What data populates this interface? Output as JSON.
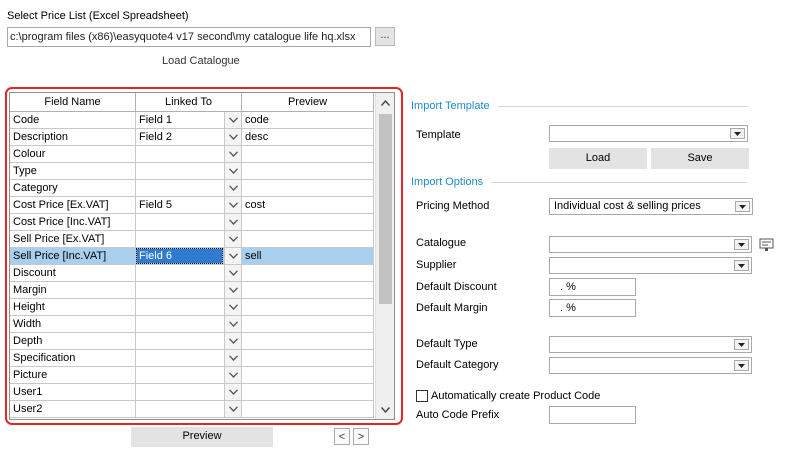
{
  "source": {
    "heading": "Select Price List (Excel Spreadsheet)",
    "path_value": "c:\\program files (x86)\\easyquote4 v17 second\\my catalogue life hq.xlsx",
    "browse_label": "...",
    "load_catalogue_label": "Load Catalogue"
  },
  "grid": {
    "headers": [
      "Field Name",
      "Linked To",
      "Preview"
    ],
    "rows": [
      {
        "field": "Code",
        "linked": "Field 1",
        "preview": "code"
      },
      {
        "field": "Description",
        "linked": "Field 2",
        "preview": "desc"
      },
      {
        "field": "Colour",
        "linked": "",
        "preview": ""
      },
      {
        "field": "Type",
        "linked": "",
        "preview": ""
      },
      {
        "field": "Category",
        "linked": "",
        "preview": ""
      },
      {
        "field": "Cost Price [Ex.VAT]",
        "linked": "Field 5",
        "preview": "cost"
      },
      {
        "field": "Cost Price [Inc.VAT]",
        "linked": "",
        "preview": ""
      },
      {
        "field": "Sell Price [Ex.VAT]",
        "linked": "",
        "preview": ""
      },
      {
        "field": "Sell Price [Inc.VAT]",
        "linked": "Field 6",
        "preview": "sell"
      },
      {
        "field": "Discount",
        "linked": "",
        "preview": ""
      },
      {
        "field": "Margin",
        "linked": "",
        "preview": ""
      },
      {
        "field": "Height",
        "linked": "",
        "preview": ""
      },
      {
        "field": "Width",
        "linked": "",
        "preview": ""
      },
      {
        "field": "Depth",
        "linked": "",
        "preview": ""
      },
      {
        "field": "Specification",
        "linked": "",
        "preview": ""
      },
      {
        "field": "Picture",
        "linked": "",
        "preview": ""
      },
      {
        "field": "User1",
        "linked": "",
        "preview": ""
      },
      {
        "field": "User2",
        "linked": "",
        "preview": ""
      }
    ],
    "selected_row_index": 8
  },
  "preview_button_label": "Preview",
  "nav": {
    "prev": "<",
    "next": ">"
  },
  "import_template": {
    "title": "Import Template",
    "template_label": "Template",
    "template_value": "",
    "load_label": "Load",
    "save_label": "Save"
  },
  "import_options": {
    "title": "Import Options",
    "pricing_method_label": "Pricing Method",
    "pricing_method_value": "Individual cost & selling prices",
    "catalogue_label": "Catalogue",
    "catalogue_value": "",
    "supplier_label": "Supplier",
    "supplier_value": "",
    "default_discount_label": "Default Discount",
    "default_discount_value": ". %",
    "default_margin_label": "Default Margin",
    "default_margin_value": ". %",
    "default_type_label": "Default Type",
    "default_type_value": "",
    "default_category_label": "Default Category",
    "default_category_value": "",
    "auto_code_checkbox_label": "Automatically create Product Code",
    "auto_code_checked": false,
    "auto_code_prefix_label": "Auto Code Prefix",
    "auto_code_prefix_value": ""
  },
  "colors": {
    "accent": "#1e8ccc",
    "highlight_frame": "#e32525",
    "selection": "#a8d0ee",
    "selection_text": "#2f7bd0"
  }
}
